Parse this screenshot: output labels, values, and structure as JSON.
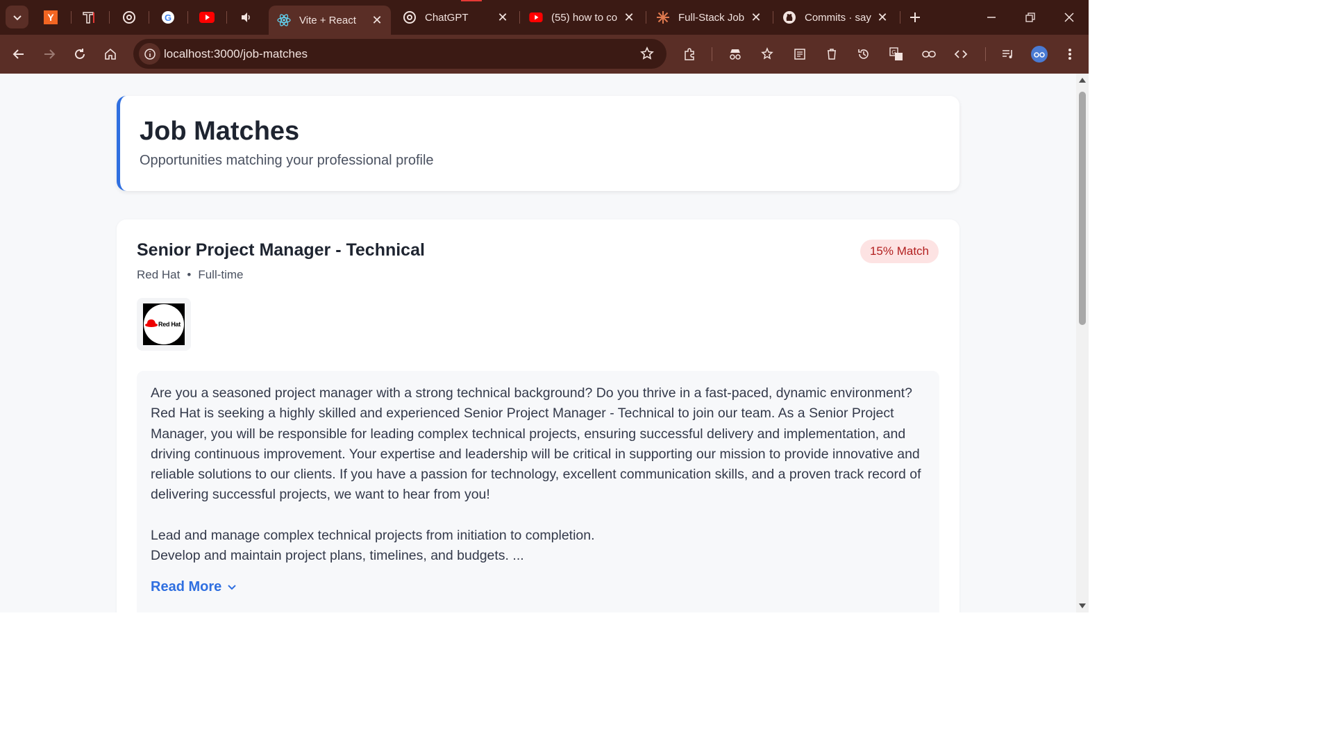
{
  "browser": {
    "tabs": [
      {
        "label": "Vite + React",
        "active": true
      },
      {
        "label": "ChatGPT",
        "active": false
      },
      {
        "label": "(55) how to co",
        "active": false
      },
      {
        "label": "Full-Stack Job",
        "active": false
      },
      {
        "label": "Commits · sayy",
        "active": false
      }
    ],
    "pinned_icons": [
      "ycombinator-icon",
      "t-icon",
      "chatgpt-icon",
      "google-icon",
      "youtube-icon",
      "speaker-icon"
    ],
    "url": "localhost:3000/job-matches"
  },
  "header": {
    "title": "Job Matches",
    "subtitle": "Opportunities matching your professional profile"
  },
  "job": {
    "title": "Senior Project Manager - Technical",
    "company": "Red Hat",
    "separator": "•",
    "type": "Full-time",
    "match": "15% Match",
    "logo_text": "Red Hat",
    "description": "Are you a seasoned project manager with a strong technical background? Do you thrive in a fast-paced, dynamic environment? Red Hat is seeking a highly skilled and experienced Senior Project Manager - Technical to join our team. As a Senior Project Manager, you will be responsible for leading complex technical projects, ensuring successful delivery and implementation, and driving continuous improvement. Your expertise and leadership will be critical in supporting our mission to provide innovative and reliable solutions to our clients. If you have a passion for technology, excellent communication skills, and a proven track record of delivering successful projects, we want to hear from you!",
    "line1": "Lead and manage complex technical projects from initiation to completion.",
    "line2": "Develop and maintain project plans, timelines, and budgets. ...",
    "read_more": "Read More"
  },
  "colors": {
    "chrome_dark": "#3b1a14",
    "chrome_mid": "#5a2e26",
    "accent": "#2f6fe0",
    "badge_bg": "#fde3e3",
    "badge_text": "#b21f1f"
  }
}
